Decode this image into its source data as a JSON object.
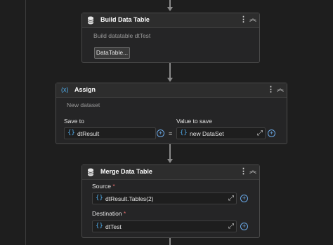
{
  "colors": {
    "background": "#1e1e1e",
    "card": "#252526",
    "header": "#2d2d2d",
    "accent": "#4fa9e6",
    "required": "#e06c6c"
  },
  "activities": {
    "build": {
      "title": "Build Data Table",
      "subtitle": "Build datatable dtTest",
      "button_label": "DataTable...",
      "icon": "database-icon",
      "kebab": "⋮",
      "collapse": "︽"
    },
    "assign": {
      "icon_text": "(x)",
      "title": "Assign",
      "subtitle": "New dataset",
      "save_to_label": "Save to",
      "value_to_save_label": "Value to save",
      "save_to_value": "dtResult",
      "value_to_save_value": "new DataSet",
      "equals": "=",
      "kebab": "⋮",
      "collapse": "︽"
    },
    "merge": {
      "title": "Merge Data Table",
      "icon": "database-icon",
      "source_label": "Source",
      "source_value": "dtResult.Tables(2)",
      "destination_label": "Destination",
      "destination_value": "dtTest",
      "required_mark": "*",
      "kebab": "⋮",
      "collapse": "︽"
    }
  },
  "field_icons": {
    "curly": "{}",
    "plus": "+",
    "expand": "⤢"
  }
}
